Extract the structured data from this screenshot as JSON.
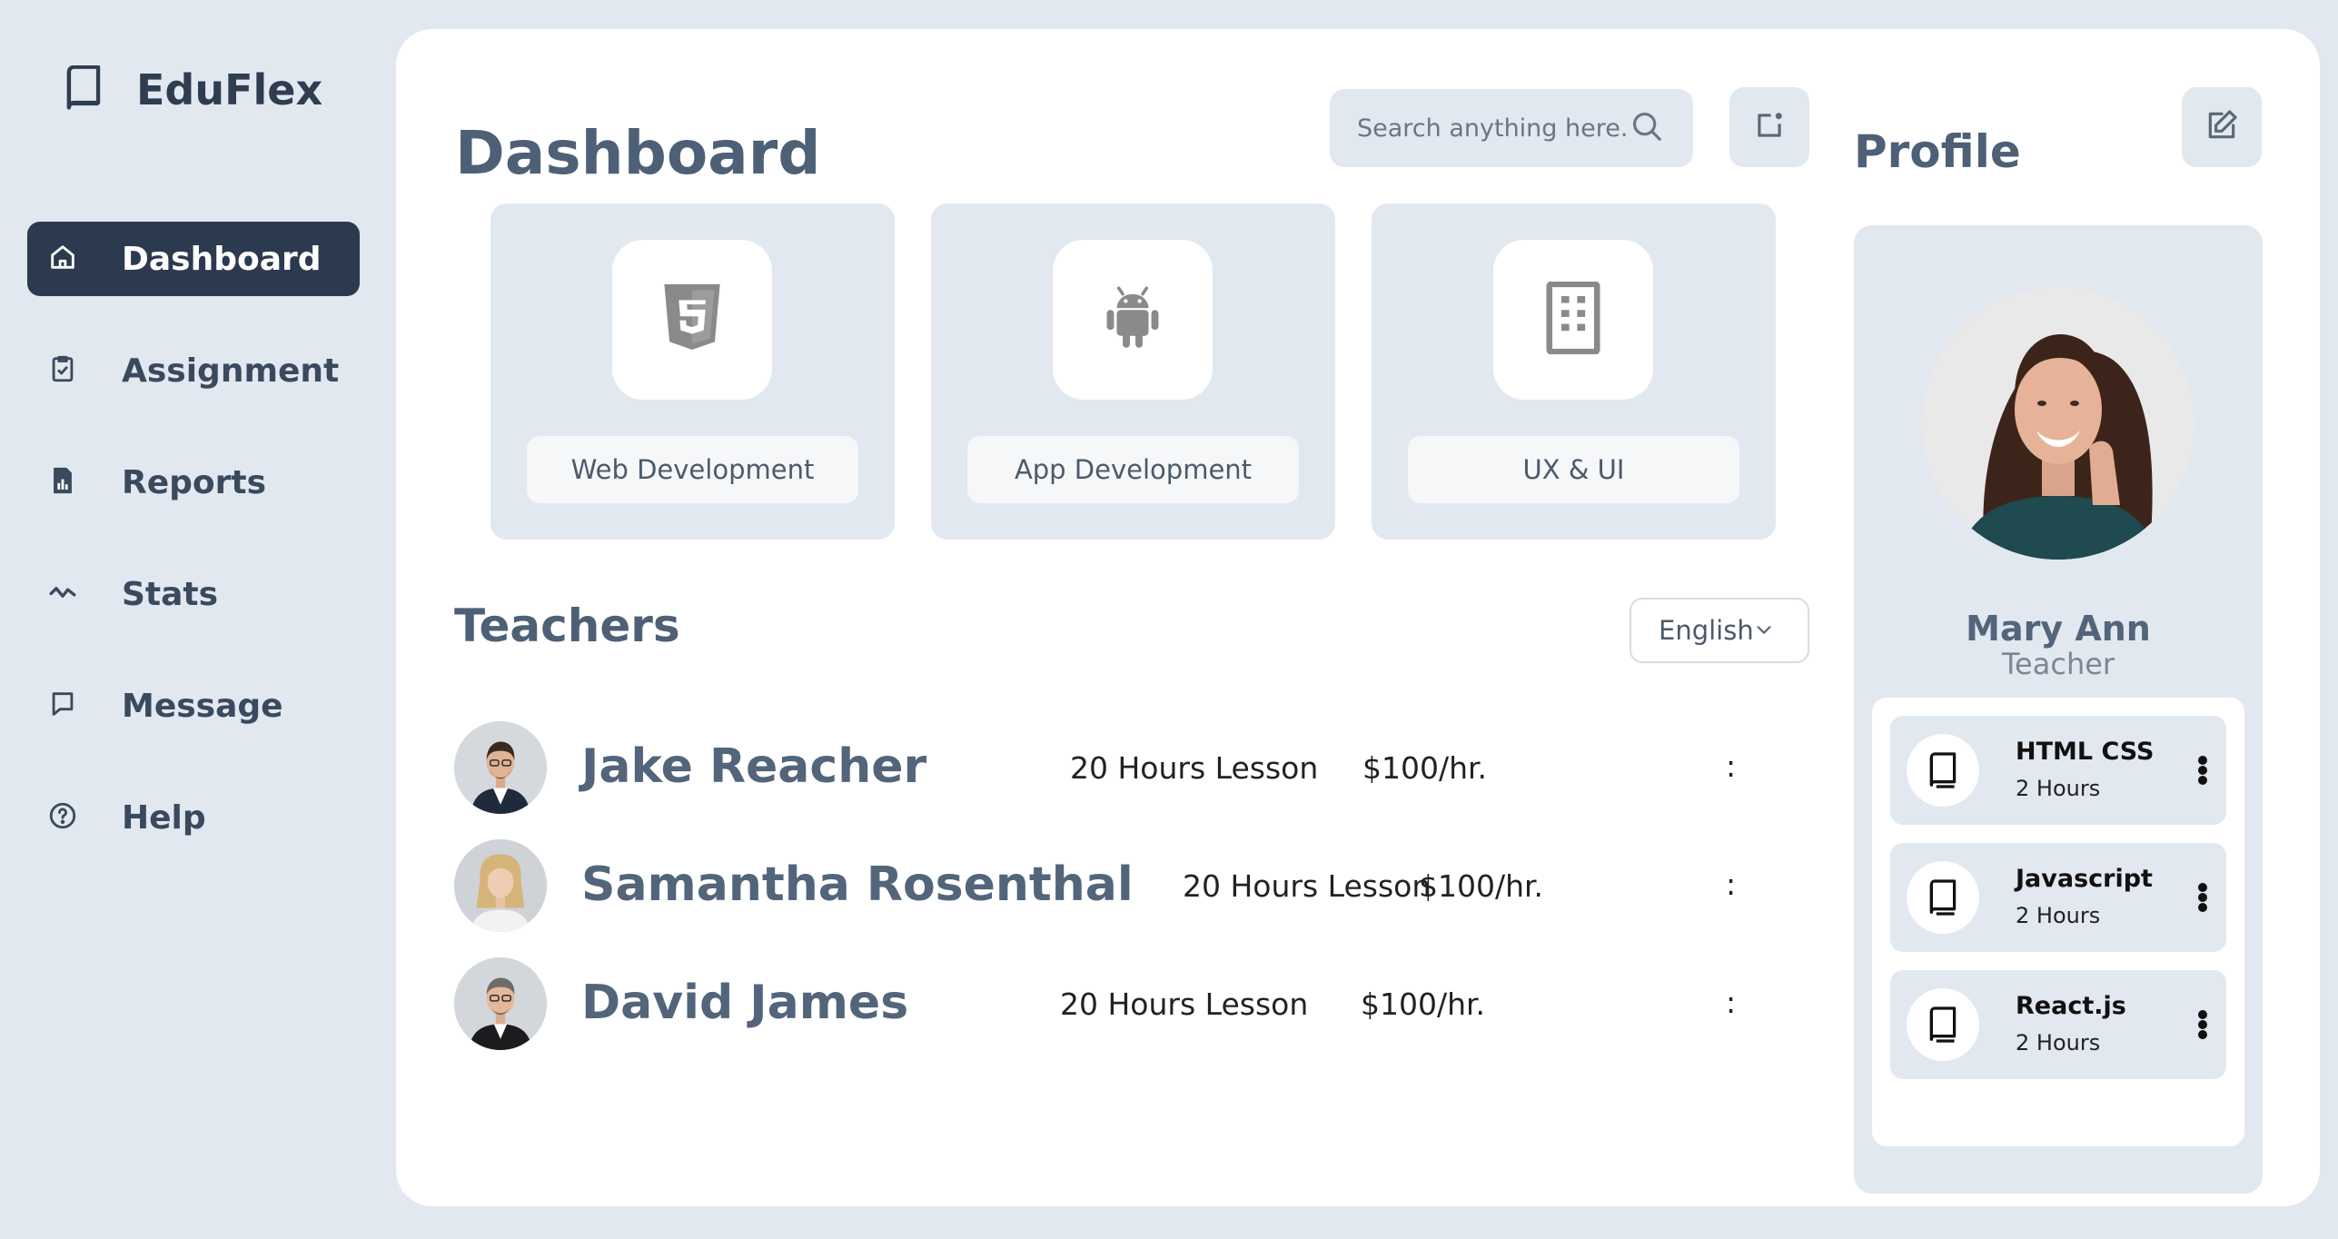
{
  "brand": {
    "name": "EduFlex",
    "icon": "book-icon"
  },
  "sidebar": {
    "items": [
      {
        "label": "Dashboard",
        "icon": "home-icon",
        "active": true
      },
      {
        "label": "Assignment",
        "icon": "clipboard-check-icon",
        "active": false
      },
      {
        "label": "Reports",
        "icon": "report-file-icon",
        "active": false
      },
      {
        "label": "Stats",
        "icon": "trend-line-icon",
        "active": false
      },
      {
        "label": "Message",
        "icon": "message-icon",
        "active": false
      },
      {
        "label": "Help",
        "icon": "help-circle-icon",
        "active": false
      }
    ]
  },
  "header": {
    "title": "Dashboard",
    "search_placeholder": "Search anything here..",
    "search_icon": "search-icon",
    "notify_icon": "notification-icon"
  },
  "categories": [
    {
      "label": "Web Development",
      "icon": "html5-icon"
    },
    {
      "label": "App Development",
      "icon": "android-icon"
    },
    {
      "label": "UX & UI",
      "icon": "building-icon"
    }
  ],
  "teachers": {
    "title": "Teachers",
    "language": "English",
    "rows": [
      {
        "name": "Jake Reacher",
        "lesson": "20 Hours Lesson",
        "price": "$100/hr.",
        "more": ":"
      },
      {
        "name": "Samantha Rosenthal",
        "lesson": "20 Hours Lesson",
        "price": "$100/hr.",
        "more": ":"
      },
      {
        "name": "David James",
        "lesson": "20 Hours Lesson",
        "price": "$100/hr.",
        "more": ":"
      }
    ]
  },
  "profile": {
    "title": "Profile",
    "edit_icon": "edit-icon",
    "name": "Mary Ann",
    "role": "Teacher",
    "courses": [
      {
        "title": "HTML CSS",
        "hours": "2 Hours"
      },
      {
        "title": "Javascript",
        "hours": "2 Hours"
      },
      {
        "title": "React.js",
        "hours": "2 Hours"
      }
    ]
  },
  "colors": {
    "background": "#e2e8ef",
    "card": "#ffffff",
    "accent_dark": "#2c3a4f",
    "heading": "#4d6076"
  }
}
